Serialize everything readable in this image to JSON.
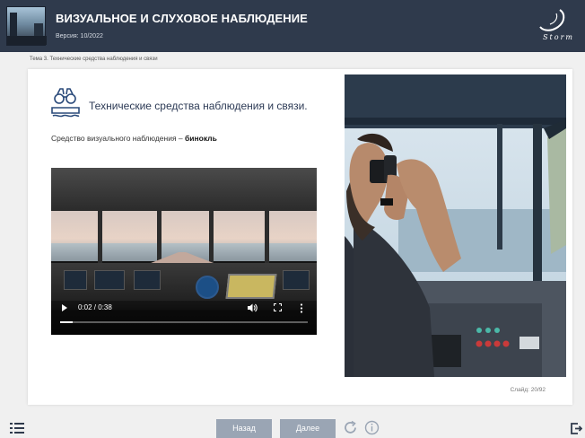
{
  "header": {
    "title": "ВИЗУАЛЬНОЕ И СЛУХОВОЕ НАБЛЮДЕНИЕ",
    "version": "Версия: 10/2022",
    "logo_text": "Storm"
  },
  "breadcrumb": "Тема 3. Технические средства наблюдения и связи",
  "slide": {
    "title": "Технические средства наблюдения и связи.",
    "subtitle_prefix": "Средство визуального наблюдения – ",
    "subtitle_bold": "бинокль",
    "counter": "Слайд: 20/92"
  },
  "video": {
    "time": "0:02 / 0:38",
    "progress": 0.05
  },
  "nav": {
    "back_label": "Назад",
    "next_label": "Далее"
  },
  "colors": {
    "header_bg": "#2f3a4c",
    "nav_button": "#9aa5b4",
    "title_text": "#2c3a55",
    "icon_blue": "#2a4a7a"
  }
}
